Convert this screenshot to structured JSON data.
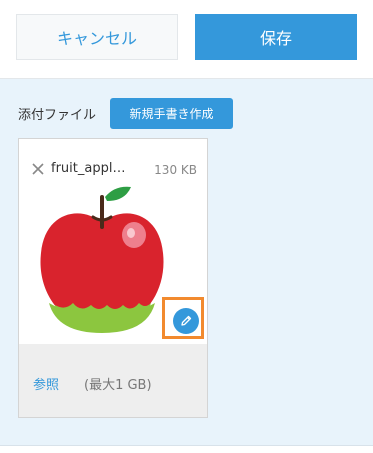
{
  "toolbar": {
    "cancel_label": "キャンセル",
    "save_label": "保存"
  },
  "attachment": {
    "label": "添付ファイル",
    "handwrite_button": "新規手書き作成",
    "file": {
      "name": "fruit_appl…",
      "size": "130 KB"
    },
    "browse_link": "参照",
    "max_size": "(最大1 GB)"
  },
  "icons": {
    "remove": "close-icon",
    "edit": "pencil-icon"
  },
  "colors": {
    "accent": "#3498db",
    "highlight": "#f28a2e",
    "panel_bg": "#e8f3fb"
  }
}
